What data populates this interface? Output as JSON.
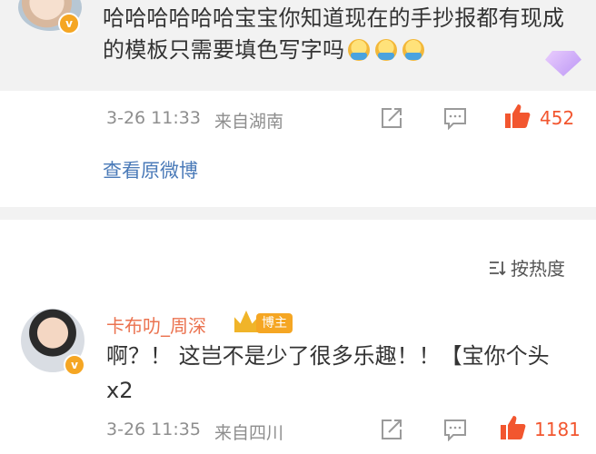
{
  "quoted_comment": {
    "text": "哈哈哈哈哈哈宝宝你知道现在的手抄报都有现成的模板只需要填色写字吗",
    "date": "3-26 11:33",
    "location": "来自湖南",
    "like_count": "452",
    "view_original": "查看原微博"
  },
  "sort": {
    "label": "按热度"
  },
  "reply": {
    "username": "卡布叻_周深",
    "badge": "博主",
    "text": "啊？！ 这岂不是少了很多乐趣！！【宝你个头x2",
    "date": "3-26 11:35",
    "location": "来自四川",
    "like_count": "1181"
  },
  "colors": {
    "accent_link": "#4a7ab8",
    "like_orange": "#f2562f",
    "username_orange": "#eb7350"
  }
}
